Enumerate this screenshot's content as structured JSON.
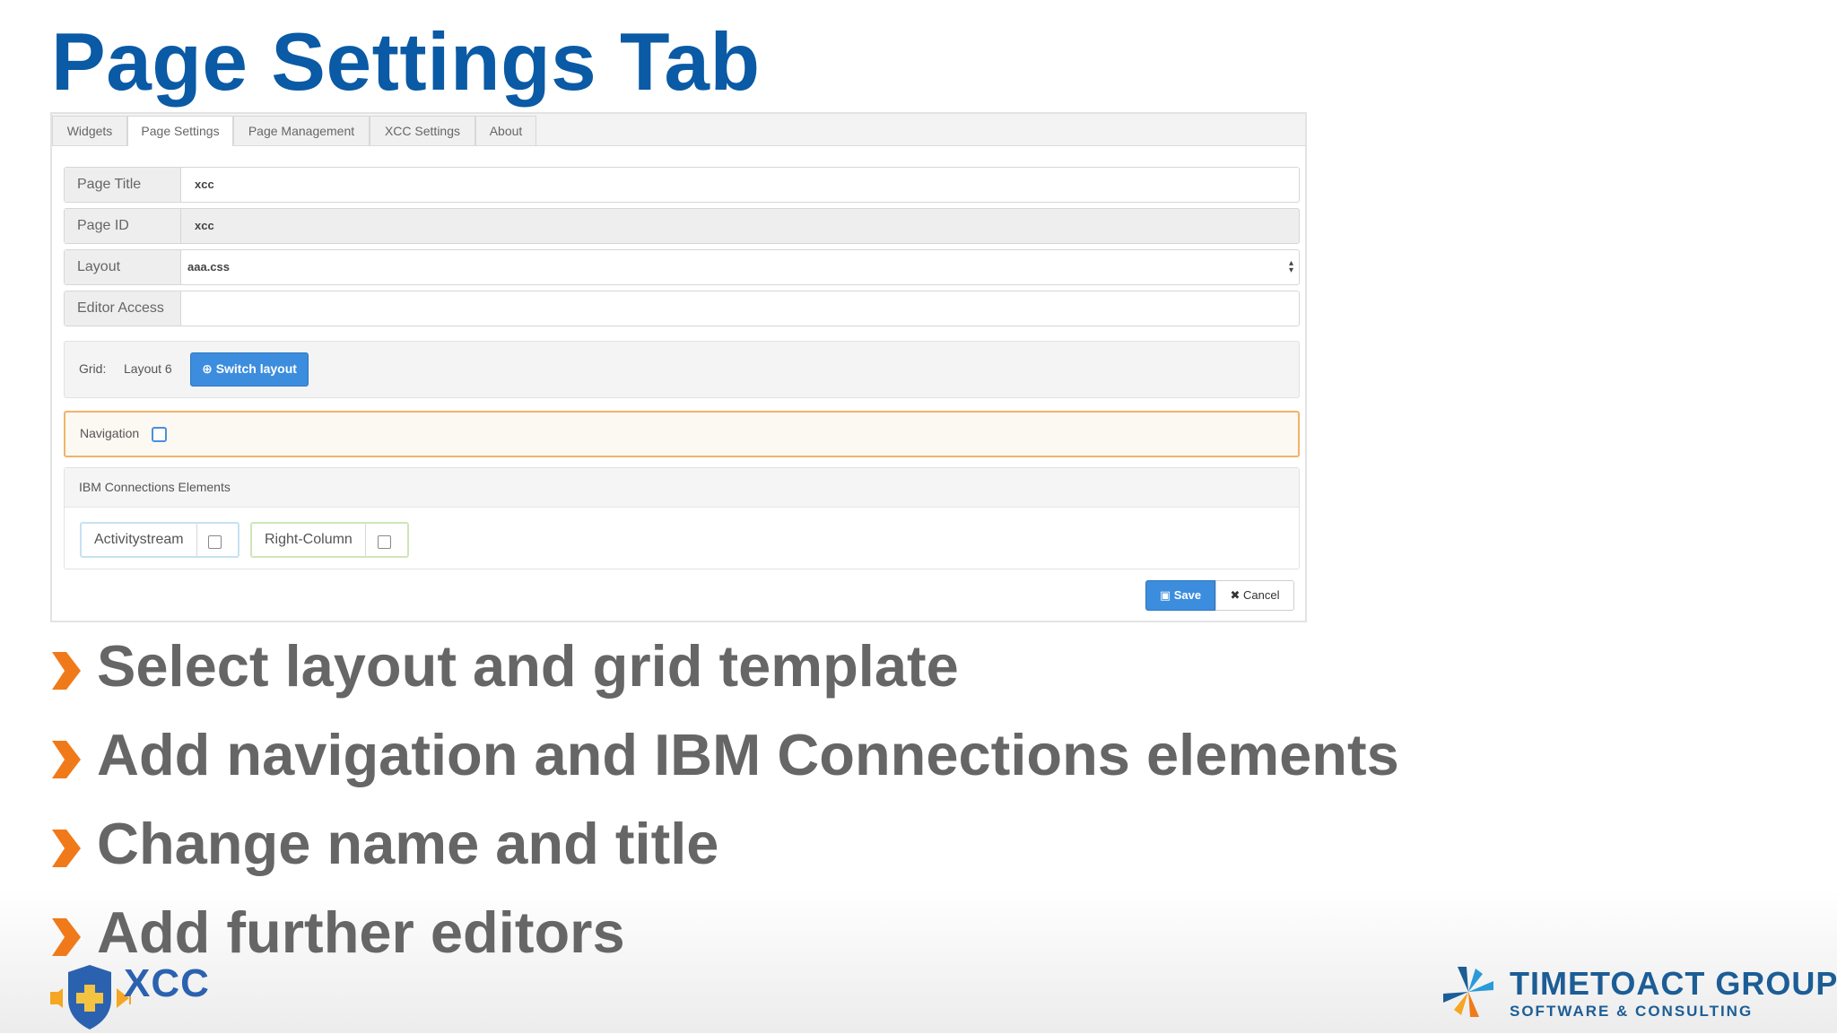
{
  "slide": {
    "title": "Page Settings Tab"
  },
  "panel": {
    "tabs": [
      "Widgets",
      "Page Settings",
      "Page Management",
      "XCC Settings",
      "About"
    ],
    "active_tab": "Page Settings",
    "fields": {
      "page_title": {
        "label": "Page Title",
        "value": "xcc"
      },
      "page_id": {
        "label": "Page ID",
        "value": "xcc"
      },
      "layout": {
        "label": "Layout",
        "value": "aaa.css"
      },
      "editor_access": {
        "label": "Editor Access",
        "value": ""
      }
    },
    "grid": {
      "label": "Grid:",
      "value": "Layout 6",
      "switch_label": "Switch layout"
    },
    "navigation": {
      "label": "Navigation",
      "checked": false
    },
    "ibm_elements": {
      "heading": "IBM Connections Elements",
      "items": [
        {
          "label": "Activitystream",
          "checked": false
        },
        {
          "label": "Right-Column",
          "checked": false
        }
      ]
    },
    "save_label": "Save",
    "cancel_label": "Cancel"
  },
  "bullets": [
    "Select layout and grid template",
    "Add navigation and IBM Connections elements",
    "Change name and title",
    "Add further editors"
  ],
  "logos": {
    "xcc": "XCC",
    "timetoact_name": "TIMETOACT GROUP",
    "timetoact_sub": "SOFTWARE & CONSULTING"
  },
  "colors": {
    "title": "#0a5aa5",
    "bullet_arrow": "#f07a1a",
    "primary_button": "#3c8dde",
    "nav_border": "#f0b46a"
  }
}
